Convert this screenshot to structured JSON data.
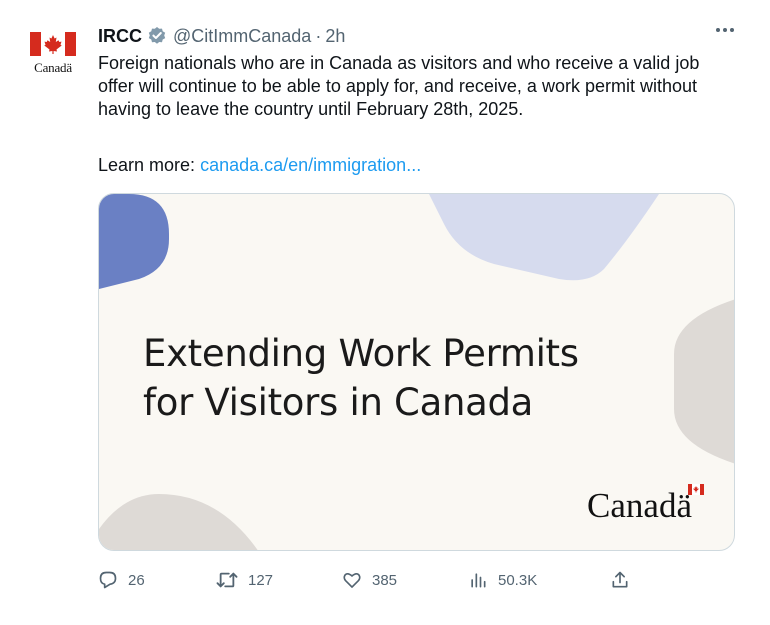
{
  "tweet": {
    "author_name": "IRCC",
    "handle": "@CitImmCanada",
    "separator": "·",
    "time": "2h",
    "avatar_wordmark": "Canadä",
    "body": "Foreign nationals who are in Canada as visitors and who receive a valid job offer will continue to be able to apply for, and receive, a work permit without having to leave the country until February 28th, 2025.",
    "learn_more_label": "Learn more:",
    "learn_more_link": "canada.ca/en/immigration...",
    "more_icon": "more-dots-icon"
  },
  "card": {
    "title_line1": "Extending Work Permits",
    "title_line2": "for Visitors in Canada",
    "wordmark": "Canadä"
  },
  "actions": {
    "replies": "26",
    "retweets": "127",
    "likes": "385",
    "views": "50.3K"
  },
  "colors": {
    "link": "#1d9bf0",
    "secondary_text": "#536471",
    "flag_red": "#d52b1e",
    "verified_badge": "#829aab"
  }
}
